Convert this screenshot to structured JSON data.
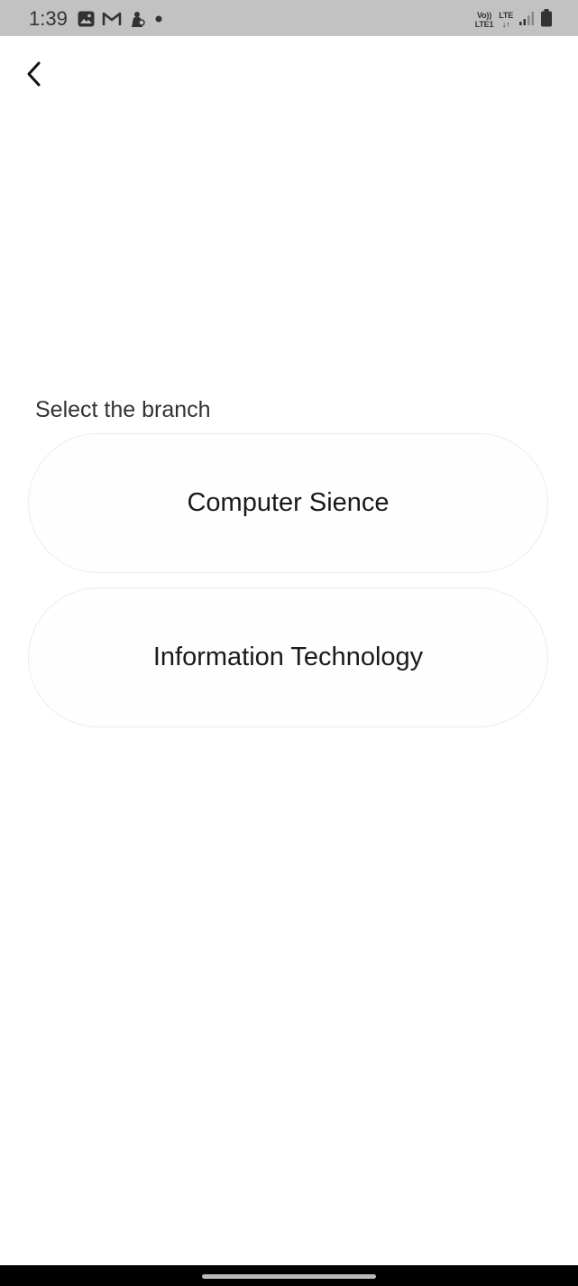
{
  "status_bar": {
    "time": "1:39",
    "network_top": "Vo))",
    "network_bottom": "LTE1",
    "data_top": "LTE",
    "data_bottom": "↓↑"
  },
  "header": {
    "back_icon": "chevron-left-icon"
  },
  "content": {
    "label": "Select the branch",
    "options": [
      {
        "label": "Computer Sience"
      },
      {
        "label": "Information Technology"
      }
    ]
  }
}
